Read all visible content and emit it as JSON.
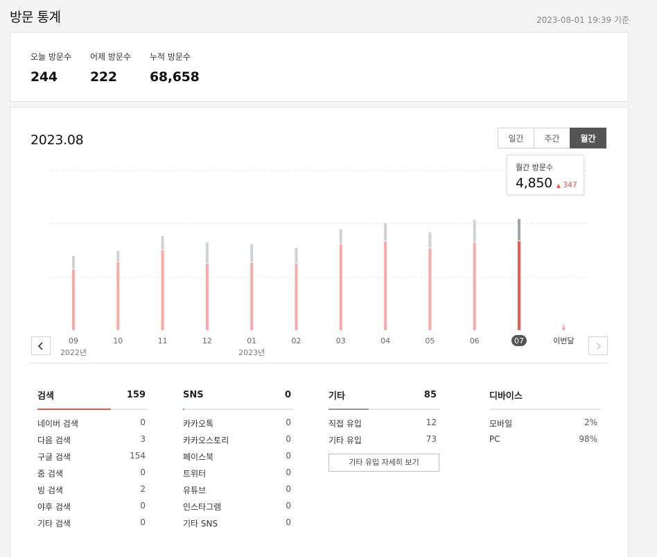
{
  "header": {
    "title": "방문 통계",
    "timestamp": "2023-08-01 19:39 기준"
  },
  "summary": {
    "today_label": "오늘 방문수",
    "today_value": "244",
    "yesterday_label": "어제 방문수",
    "yesterday_value": "222",
    "total_label": "누적 방문수",
    "total_value": "68,658"
  },
  "chart_section": {
    "period_title": "2023.08",
    "tabs": [
      {
        "label": "일간",
        "active": false
      },
      {
        "label": "주간",
        "active": false
      },
      {
        "label": "월간",
        "active": true
      }
    ],
    "tooltip": {
      "label": "월간 방문수",
      "value": "4,850",
      "change": "347"
    }
  },
  "chart_data": {
    "type": "bar",
    "categories": [
      "09",
      "10",
      "11",
      "12",
      "01",
      "02",
      "03",
      "04",
      "05",
      "06",
      "07",
      "이번달"
    ],
    "year_labels": [
      {
        "label": "2022년",
        "index": 0
      },
      {
        "label": "2023년",
        "index": 4
      }
    ],
    "selected_index": 10,
    "series": [
      {
        "values": [
          3660,
          4090,
          4830,
          3990,
          4060,
          4000,
          5160,
          5330,
          4930,
          5270,
          5360,
          190
        ]
      },
      {
        "values": [
          770,
          640,
          800,
          1250,
          1090,
          900,
          880,
          1060,
          920,
          1320,
          1290,
          110
        ]
      }
    ],
    "ylim": [
      0,
      9600
    ],
    "grid": true,
    "colors": {
      "primary": "#f9aba3",
      "primary_selected": "#f4584a",
      "secondary": "#cfd2d3",
      "secondary_selected": "#9fa6aa",
      "selected_badge": "#555555"
    }
  },
  "panels": {
    "search": {
      "title": "검색",
      "count": "159",
      "accent": "#f4584a",
      "fill_ratio": 0.66,
      "rows": [
        {
          "label": "네이버 검색",
          "value": "0"
        },
        {
          "label": "다음 검색",
          "value": "3"
        },
        {
          "label": "구글 검색",
          "value": "154"
        },
        {
          "label": "줌 검색",
          "value": "0"
        },
        {
          "label": "빙 검색",
          "value": "2"
        },
        {
          "label": "야후 검색",
          "value": "0"
        },
        {
          "label": "기타 검색",
          "value": "0"
        }
      ]
    },
    "sns": {
      "title": "SNS",
      "count": "0",
      "accent": "#44b39a",
      "fill_ratio": 0.01,
      "rows": [
        {
          "label": "카카오톡",
          "value": "0"
        },
        {
          "label": "카카오스토리",
          "value": "0"
        },
        {
          "label": "페이스북",
          "value": "0"
        },
        {
          "label": "트위터",
          "value": "0"
        },
        {
          "label": "유튜브",
          "value": "0"
        },
        {
          "label": "인스타그램",
          "value": "0"
        },
        {
          "label": "기타 SNS",
          "value": "0"
        }
      ]
    },
    "other": {
      "title": "기타",
      "count": "85",
      "accent": "#8c99a6",
      "fill_ratio": 0.36,
      "rows": [
        {
          "label": "직접 유입",
          "value": "12"
        },
        {
          "label": "기타 유입",
          "value": "73"
        }
      ],
      "detail_button": "기타 유입 자세히 보기"
    },
    "device": {
      "title": "디바이스",
      "accent": "#e5e5e5",
      "rows": [
        {
          "label": "모바일",
          "value": "2%"
        },
        {
          "label": "PC",
          "value": "98%"
        }
      ]
    }
  }
}
